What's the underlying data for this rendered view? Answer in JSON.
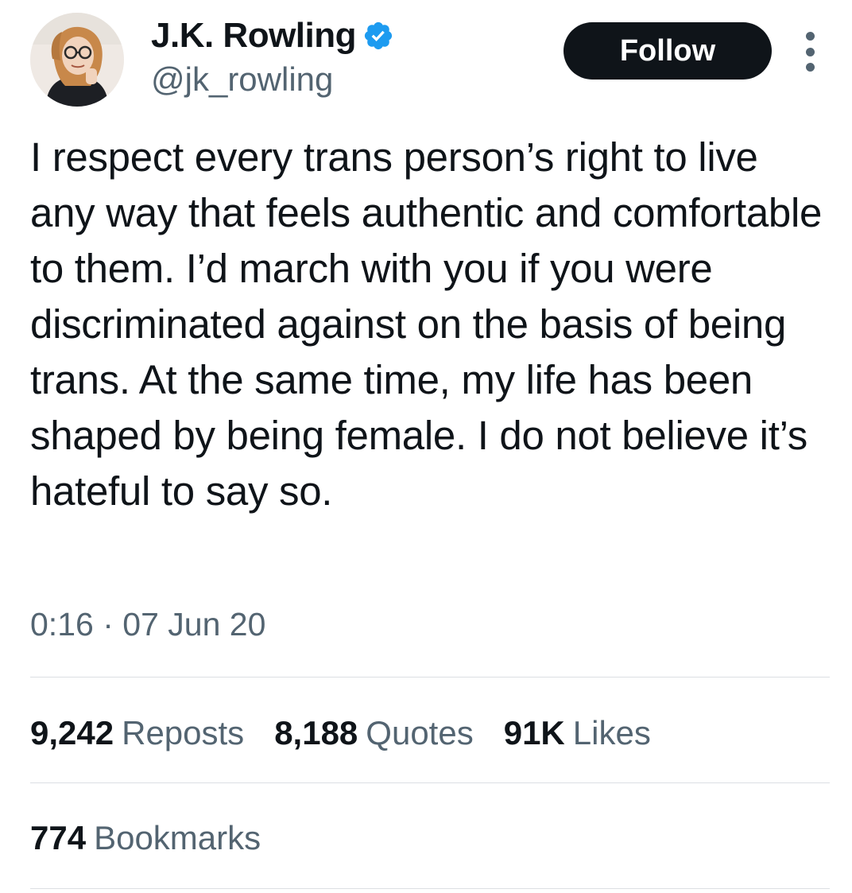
{
  "author": {
    "display_name": "J.K. Rowling",
    "handle": "@jk_rowling",
    "verified": true,
    "verified_color": "#1d9bf0"
  },
  "actions": {
    "follow_label": "Follow",
    "more_icon": "more-vertical-icon"
  },
  "tweet": {
    "text": "I respect every trans person’s right to live any way that feels authentic and comfortable to them. I’d march with you if you were discriminated against on the basis of being trans. At the same time, my life has been shaped by being female. I do not believe it’s hateful to say so.",
    "time": "0:16",
    "separator": "·",
    "date": "07 Jun 20"
  },
  "stats": {
    "reposts_count": "9,242",
    "reposts_label": "Reposts",
    "quotes_count": "8,188",
    "quotes_label": "Quotes",
    "likes_count": "91K",
    "likes_label": "Likes",
    "bookmarks_count": "774",
    "bookmarks_label": "Bookmarks"
  },
  "colors": {
    "text_primary": "#0f1419",
    "text_secondary": "#536471",
    "follow_bg": "#0f1419",
    "divider": "#dcdfe3"
  }
}
